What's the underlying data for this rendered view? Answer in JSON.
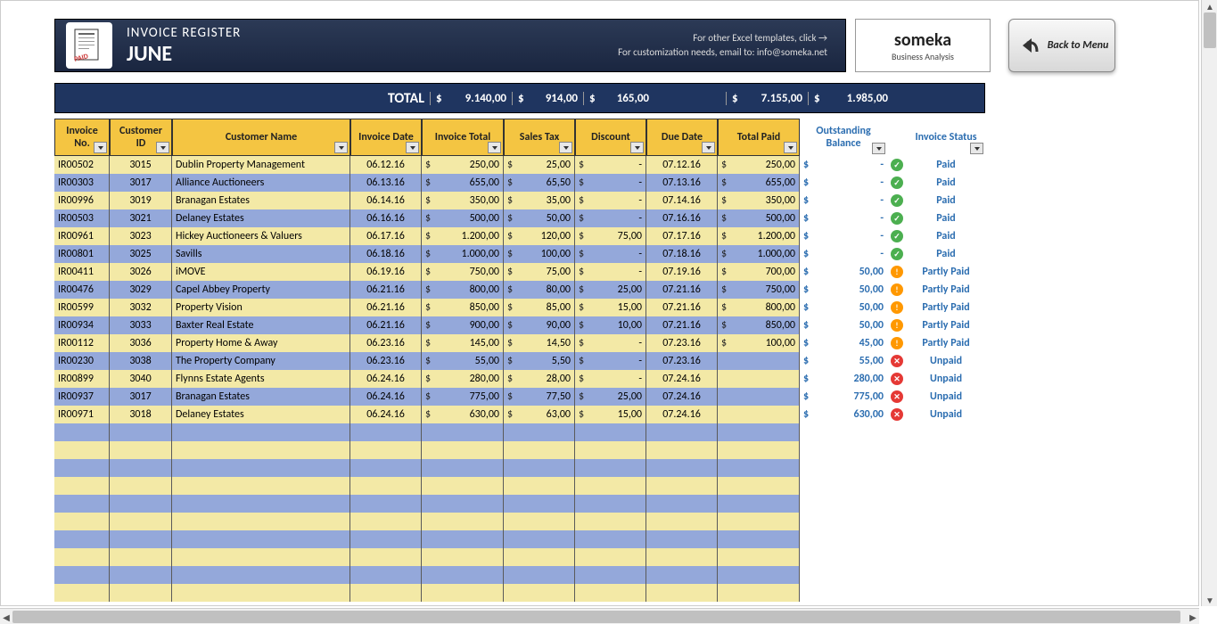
{
  "header": {
    "title": "INVOICE REGISTER",
    "month": "JUNE",
    "templatesText": "For other Excel templates, click →",
    "customText": "For customization needs, email to: info@someka.net",
    "backLabel": "Back to Menu"
  },
  "logo": {
    "name": "someka",
    "sub": "Business Analysis"
  },
  "totals": {
    "label": "TOTAL",
    "invoiceTotal": "9.140,00",
    "salesTax": "914,00",
    "discount": "165,00",
    "totalPaid": "7.155,00",
    "outstanding": "1.985,00"
  },
  "columns": {
    "invoiceNo": "Invoice No.",
    "customerId": "Customer ID",
    "customerName": "Customer Name",
    "invoiceDate": "Invoice Date",
    "invoiceTotal": "Invoice Total",
    "salesTax": "Sales Tax",
    "discount": "Discount",
    "dueDate": "Due Date",
    "totalPaid": "Total Paid",
    "outstanding": "Outstanding Balance",
    "status": "Invoice Status"
  },
  "currency": "$",
  "statusLabels": {
    "paid": "Paid",
    "partly": "Partly Paid",
    "unpaid": "Unpaid"
  },
  "rows": [
    {
      "no": "IR00502",
      "cid": "3015",
      "name": "Dublin Property Management",
      "date": "06.12.16",
      "total": "250,00",
      "tax": "25,00",
      "disc": "-",
      "due": "07.12.16",
      "paid": "250,00",
      "bal": "-",
      "status": "paid"
    },
    {
      "no": "IR00303",
      "cid": "3017",
      "name": "Alliance Auctioneers",
      "date": "06.13.16",
      "total": "655,00",
      "tax": "65,50",
      "disc": "-",
      "due": "07.13.16",
      "paid": "655,00",
      "bal": "-",
      "status": "paid"
    },
    {
      "no": "IR00996",
      "cid": "3019",
      "name": "Branagan Estates",
      "date": "06.14.16",
      "total": "350,00",
      "tax": "35,00",
      "disc": "-",
      "due": "07.14.16",
      "paid": "350,00",
      "bal": "-",
      "status": "paid"
    },
    {
      "no": "IR00503",
      "cid": "3021",
      "name": "Delaney Estates",
      "date": "06.16.16",
      "total": "500,00",
      "tax": "50,00",
      "disc": "-",
      "due": "07.16.16",
      "paid": "500,00",
      "bal": "-",
      "status": "paid"
    },
    {
      "no": "IR00961",
      "cid": "3023",
      "name": "Hickey Auctioneers & Valuers",
      "date": "06.17.16",
      "total": "1.200,00",
      "tax": "120,00",
      "disc": "75,00",
      "due": "07.17.16",
      "paid": "1.200,00",
      "bal": "-",
      "status": "paid"
    },
    {
      "no": "IR00801",
      "cid": "3025",
      "name": "Savills",
      "date": "06.18.16",
      "total": "1.000,00",
      "tax": "100,00",
      "disc": "-",
      "due": "07.18.16",
      "paid": "1.000,00",
      "bal": "-",
      "status": "paid"
    },
    {
      "no": "IR00411",
      "cid": "3026",
      "name": "iMOVE",
      "date": "06.19.16",
      "total": "750,00",
      "tax": "75,00",
      "disc": "-",
      "due": "07.19.16",
      "paid": "700,00",
      "bal": "50,00",
      "status": "partly"
    },
    {
      "no": "IR00476",
      "cid": "3029",
      "name": "Capel Abbey Property",
      "date": "06.21.16",
      "total": "800,00",
      "tax": "80,00",
      "disc": "25,00",
      "due": "07.21.16",
      "paid": "750,00",
      "bal": "50,00",
      "status": "partly"
    },
    {
      "no": "IR00599",
      "cid": "3032",
      "name": "Property Vision",
      "date": "06.21.16",
      "total": "850,00",
      "tax": "85,00",
      "disc": "15,00",
      "due": "07.21.16",
      "paid": "800,00",
      "bal": "50,00",
      "status": "partly"
    },
    {
      "no": "IR00934",
      "cid": "3033",
      "name": "Baxter Real Estate",
      "date": "06.21.16",
      "total": "900,00",
      "tax": "90,00",
      "disc": "10,00",
      "due": "07.21.16",
      "paid": "850,00",
      "bal": "50,00",
      "status": "partly"
    },
    {
      "no": "IR00112",
      "cid": "3036",
      "name": "Property Home & Away",
      "date": "06.23.16",
      "total": "145,00",
      "tax": "14,50",
      "disc": "-",
      "due": "07.23.16",
      "paid": "100,00",
      "bal": "45,00",
      "status": "partly"
    },
    {
      "no": "IR00230",
      "cid": "3038",
      "name": "The Property Company",
      "date": "06.23.16",
      "total": "55,00",
      "tax": "5,50",
      "disc": "-",
      "due": "07.23.16",
      "paid": "",
      "bal": "55,00",
      "status": "unpaid"
    },
    {
      "no": "IR00899",
      "cid": "3040",
      "name": "Flynns Estate Agents",
      "date": "06.24.16",
      "total": "280,00",
      "tax": "28,00",
      "disc": "-",
      "due": "07.24.16",
      "paid": "",
      "bal": "280,00",
      "status": "unpaid"
    },
    {
      "no": "IR00937",
      "cid": "3017",
      "name": "Branagan Estates",
      "date": "06.24.16",
      "total": "775,00",
      "tax": "77,50",
      "disc": "25,00",
      "due": "07.24.16",
      "paid": "",
      "bal": "775,00",
      "status": "unpaid"
    },
    {
      "no": "IR00971",
      "cid": "3018",
      "name": "Delaney Estates",
      "date": "06.24.16",
      "total": "630,00",
      "tax": "63,00",
      "disc": "15,00",
      "due": "07.24.16",
      "paid": "",
      "bal": "630,00",
      "status": "unpaid"
    }
  ],
  "emptyRows": 10
}
